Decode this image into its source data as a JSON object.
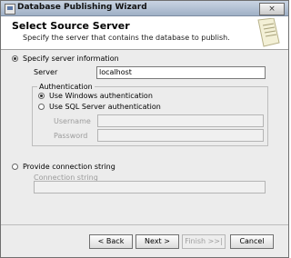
{
  "window": {
    "title": "Database Publishing Wizard",
    "close_glyph": "×"
  },
  "header": {
    "title": "Select Source Server",
    "subtitle": "Specify the server that contains the database to publish."
  },
  "server_info": {
    "option_label": "Specify server information",
    "server_label": "Server",
    "server_value": "localhost",
    "auth_group_label": "Authentication",
    "windows_auth_label": "Use Windows authentication",
    "sql_auth_label": "Use SQL Server authentication",
    "username_label": "Username",
    "password_label": "Password"
  },
  "connection": {
    "option_label": "Provide connection string",
    "field_label": "Connection string"
  },
  "buttons": {
    "back": "< Back",
    "next": "Next >",
    "finish": "Finish >>|",
    "cancel": "Cancel"
  }
}
